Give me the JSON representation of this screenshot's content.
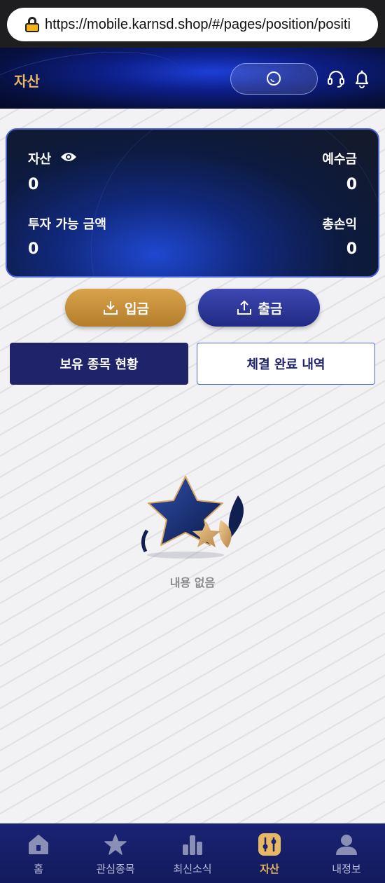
{
  "browser": {
    "url": "https://mobile.karnsd.shop/#/pages/position/positi"
  },
  "header": {
    "title": "자산"
  },
  "asset_card": {
    "asset_label": "자산",
    "asset_value": "0",
    "deposit_balance_label": "예수금",
    "deposit_balance_value": "0",
    "available_label": "투자 가능 금액",
    "available_value": "0",
    "pnl_label": "총손익",
    "pnl_value": "0"
  },
  "actions": {
    "deposit_label": "입금",
    "withdraw_label": "출금"
  },
  "tabs": {
    "holdings_label": "보유 종목 현황",
    "executed_label": "체결 완료 내역"
  },
  "empty": {
    "text": "내용 없음"
  },
  "nav": [
    {
      "label": "홈",
      "icon": "home-icon"
    },
    {
      "label": "관심종목",
      "icon": "star-icon"
    },
    {
      "label": "최신소식",
      "icon": "chart-icon"
    },
    {
      "label": "자산",
      "icon": "assets-icon"
    },
    {
      "label": "내정보",
      "icon": "user-icon"
    }
  ],
  "colors": {
    "accent_gold": "#e8b761",
    "navy": "#1f236a",
    "nav_bg": "#1a2374"
  }
}
